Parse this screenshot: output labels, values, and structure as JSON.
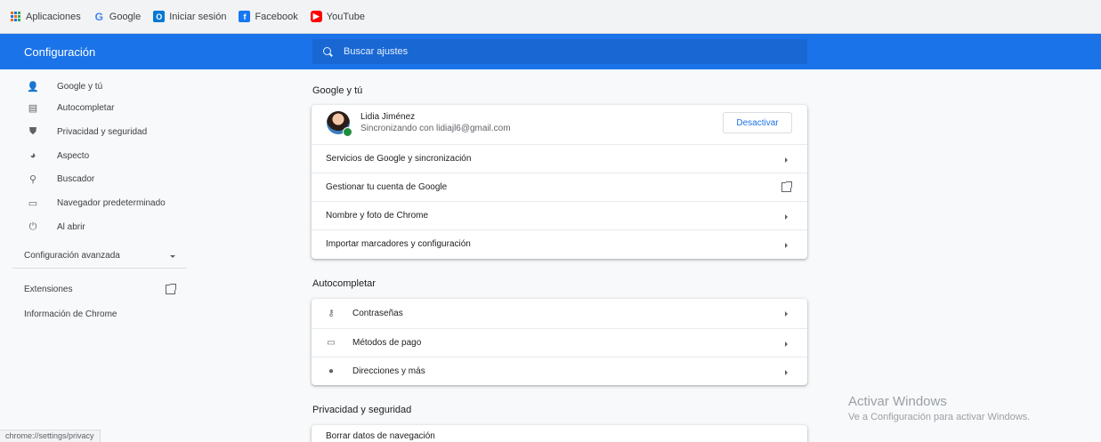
{
  "bookmarks": [
    {
      "label": "Aplicaciones",
      "icon": "apps-grid-icon"
    },
    {
      "label": "Google",
      "icon": "google-icon"
    },
    {
      "label": "Iniciar sesión",
      "icon": "outlook-icon"
    },
    {
      "label": "Facebook",
      "icon": "facebook-icon"
    },
    {
      "label": "YouTube",
      "icon": "youtube-icon"
    }
  ],
  "header": {
    "title": "Configuración",
    "search_placeholder": "Buscar ajustes",
    "accent_color": "#1a73e8"
  },
  "sidebar": {
    "items": [
      {
        "label": "Google y tú",
        "icon": "person-icon"
      },
      {
        "label": "Autocompletar",
        "icon": "clipboard-icon"
      },
      {
        "label": "Privacidad y seguridad",
        "icon": "shield-icon"
      },
      {
        "label": "Aspecto",
        "icon": "palette-icon"
      },
      {
        "label": "Buscador",
        "icon": "search-icon"
      },
      {
        "label": "Navegador predeterminado",
        "icon": "browser-icon"
      },
      {
        "label": "Al abrir",
        "icon": "power-icon"
      }
    ],
    "advanced": "Configuración avanzada",
    "extensions": "Extensiones",
    "about": "Información de Chrome"
  },
  "main": {
    "google": {
      "title": "Google y tú",
      "profile_name": "Lidia Jiménez",
      "profile_status": "Sincronizando con lidiajl6@gmail.com",
      "disable_button": "Desactivar",
      "rows": [
        "Servicios de Google y sincronización",
        "Gestionar tu cuenta de Google",
        "Nombre y foto de Chrome",
        "Importar marcadores y configuración"
      ]
    },
    "autofill": {
      "title": "Autocompletar",
      "rows": [
        {
          "label": "Contraseñas",
          "icon": "key-icon"
        },
        {
          "label": "Métodos de pago",
          "icon": "credit-card-icon"
        },
        {
          "label": "Direcciones y más",
          "icon": "location-pin-icon"
        }
      ]
    },
    "privacy": {
      "title": "Privacidad y seguridad",
      "rows": [
        "Borrar datos de navegación"
      ]
    }
  },
  "watermark": {
    "line1": "Activar Windows",
    "line2": "Ve a Configuración para activar Windows."
  },
  "status_url": "chrome://settings/privacy"
}
